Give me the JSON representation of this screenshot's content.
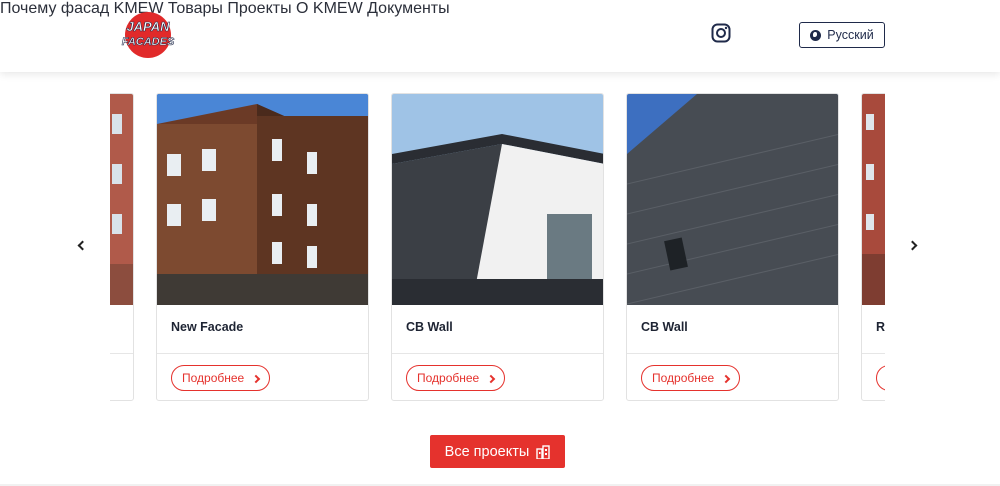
{
  "header": {
    "logo_text": "JAPAN FACADES",
    "nav": [
      {
        "label": "Почему фасад KMEW"
      },
      {
        "label": "Товары"
      },
      {
        "label": "Проекты"
      },
      {
        "label": "О KMEW"
      },
      {
        "label": "Документы"
      }
    ],
    "instagram_icon": "instagram-icon",
    "language": "Русский"
  },
  "carousel": {
    "cards": [
      {
        "title": "",
        "button": ""
      },
      {
        "title": "New Facade",
        "button": "Подробнее"
      },
      {
        "title": "CB Wall",
        "button": "Подробнее"
      },
      {
        "title": "CB Wall",
        "button": "Подробнее"
      },
      {
        "title": "R",
        "button": ""
      }
    ]
  },
  "all_projects": "Все проекты",
  "colors": {
    "accent": "#e5322d",
    "nav_text": "#1f2a4a"
  }
}
